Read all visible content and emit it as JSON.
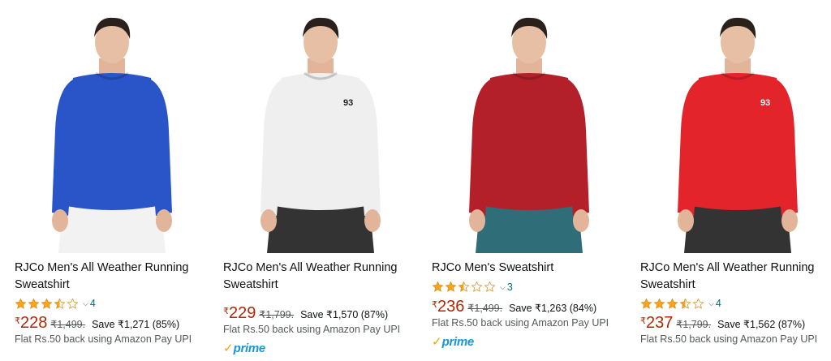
{
  "colors": {
    "price": "#b12704",
    "link": "#007185",
    "star": "#f7a31c",
    "prime_blue": "#1399d6",
    "prime_check": "#f7a200"
  },
  "products": [
    {
      "title": "RJCo Men's All Weather Running Sweatshirt",
      "rating": 3.5,
      "rating_count": "4",
      "currency": "₹",
      "price": "228",
      "mrp": "₹1,499.",
      "save": "Save ₹1,271 (85%)",
      "offer": "Flat Rs.50 back using Amazon Pay UPI",
      "prime": false,
      "shirt_color": "#2a55c8",
      "shirt_logo": "",
      "pants_color": "#f2f2f2"
    },
    {
      "title": "RJCo Men's All Weather Running Sweatshirt",
      "rating": null,
      "rating_count": "",
      "currency": "₹",
      "price": "229",
      "mrp": "₹1,799.",
      "save": "Save ₹1,570 (87%)",
      "offer": "Flat Rs.50 back using Amazon Pay UPI",
      "prime": true,
      "prime_label": "prime",
      "shirt_color": "#efefef",
      "shirt_logo": "93",
      "pants_color": "#333333"
    },
    {
      "title": "RJCo Men's Sweatshirt",
      "rating": 2.5,
      "rating_count": "3",
      "currency": "₹",
      "price": "236",
      "mrp": "₹1,499.",
      "save": "Save ₹1,263 (84%)",
      "offer": "Flat Rs.50 back using Amazon Pay UPI",
      "prime": true,
      "prime_label": "prime",
      "shirt_color": "#b3202a",
      "shirt_logo": "",
      "pants_color": "#2f6e78"
    },
    {
      "title": "RJCo Men's All Weather Running Sweatshirt",
      "rating": 3.5,
      "rating_count": "4",
      "currency": "₹",
      "price": "237",
      "mrp": "₹1,799.",
      "save": "Save ₹1,562 (87%)",
      "offer": "Flat Rs.50 back using Amazon Pay UPI",
      "prime": false,
      "shirt_color": "#e3242b",
      "shirt_logo": "93",
      "pants_color": "#333333"
    }
  ]
}
